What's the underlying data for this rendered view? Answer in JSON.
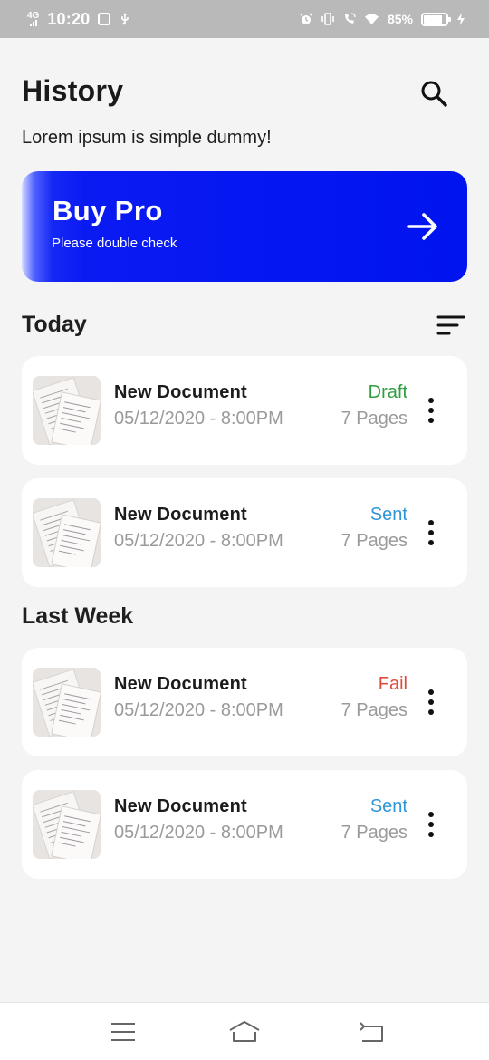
{
  "status_bar": {
    "network": "4G",
    "time": "10:20",
    "battery_percent": "85%",
    "battery_level": 0.85,
    "icons": [
      "sim-badge-icon",
      "usb-icon",
      "alarm-icon",
      "vibrate-icon",
      "wifi-calling-icon",
      "wifi-icon",
      "battery-icon",
      "charging-icon"
    ]
  },
  "header": {
    "title": "History",
    "subtitle": "Lorem ipsum is simple dummy!",
    "search_icon": "search-icon"
  },
  "promo": {
    "title": "Buy Pro",
    "subtitle": "Please double check",
    "arrow_icon": "arrow-right-icon"
  },
  "sections": [
    {
      "title": "Today",
      "sort_icon": "sort-icon",
      "items": [
        {
          "name": "New Document",
          "date": "05/12/2020 - 8:00PM",
          "status": "Draft",
          "status_color": "#2e9e3f",
          "pages": "7 Pages"
        },
        {
          "name": "New Document",
          "date": "05/12/2020 - 8:00PM",
          "status": "Sent",
          "status_color": "#2f95d8",
          "pages": "7 Pages"
        }
      ]
    },
    {
      "title": "Last Week",
      "items": [
        {
          "name": "New Document",
          "date": "05/12/2020 - 8:00PM",
          "status": "Fail",
          "status_color": "#e04b3c",
          "pages": "7 Pages"
        },
        {
          "name": "New Document",
          "date": "05/12/2020 - 8:00PM",
          "status": "Sent",
          "status_color": "#2f95d8",
          "pages": "7 Pages"
        }
      ]
    }
  ],
  "nav_bar": {
    "icons": [
      "menu-icon",
      "home-icon",
      "back-icon"
    ]
  },
  "colors": {
    "background": "#f4f4f4",
    "accent": "#0014f0",
    "card": "#ffffff",
    "muted_text": "#9a9a9a"
  }
}
